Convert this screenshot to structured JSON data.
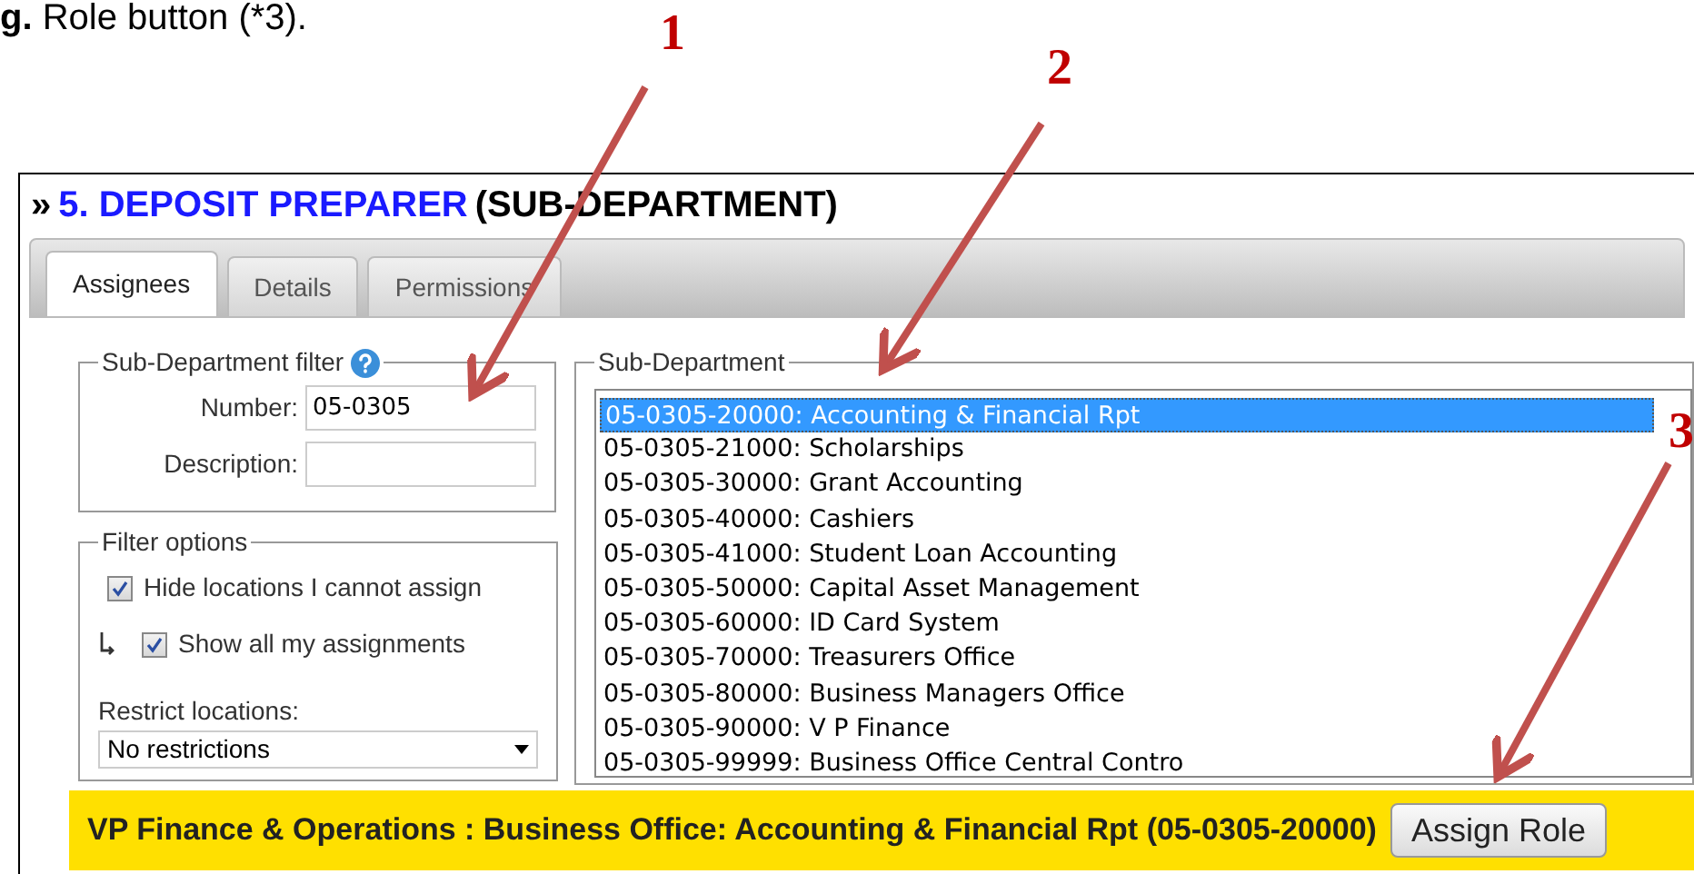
{
  "caption": "**g.** Role button (*3).",
  "panel": {
    "prefix": "»",
    "title": "5. DEPOSIT PREPARER",
    "suffix": "(SUB-DEPARTMENT)"
  },
  "tabs": [
    {
      "label": "Assignees",
      "selected": true
    },
    {
      "label": "Details",
      "selected": false
    },
    {
      "label": "Permissions",
      "selected": false
    }
  ],
  "sub_department_filter": {
    "legend": "Sub-Department filter",
    "number_label": "Number:",
    "number_value": "05-0305",
    "description_label": "Description:"
  },
  "filter_options": {
    "legend": "Filter options",
    "options": [
      {
        "label": "Hide locations I cannot assign",
        "checked": true,
        "nested": false
      },
      {
        "label": "Show all my assignments",
        "checked": true,
        "nested": true
      }
    ],
    "restrict_label": "Restrict locations:",
    "restrict_value": "No restrictions"
  },
  "sub_department": {
    "legend": "Sub-Department",
    "items": [
      {
        "label": "05-0305-20000: Accounting & Financial Rpt",
        "selected": true
      },
      {
        "label": "05-0305-21000: Scholarships",
        "selected": false
      },
      {
        "label": "05-0305-30000: Grant Accounting",
        "selected": false
      },
      {
        "label": "05-0305-40000: Cashiers",
        "selected": false
      },
      {
        "label": "05-0305-41000: Student Loan Accounting",
        "selected": false
      },
      {
        "label": "05-0305-50000: Capital Asset Management",
        "selected": false
      },
      {
        "label": "05-0305-60000: ID Card System",
        "selected": false
      },
      {
        "label": "05-0305-70000: Treasurers Office",
        "selected": false
      },
      {
        "label": "05-0305-80000: Business Managers Office",
        "selected": false
      },
      {
        "label": "05-0305-90000: V P Finance",
        "selected": false
      },
      {
        "label": "05-0305-99999: Business Office Central Contro",
        "selected": false
      }
    ]
  },
  "selection_bar": {
    "text": "VP Finance & Operations : Business Office: Accounting & Financial Rpt (05-0305-20000)",
    "button": "Assign Role"
  },
  "annotations": [
    {
      "number": "1"
    },
    {
      "number": "2"
    },
    {
      "number": "3"
    }
  ]
}
